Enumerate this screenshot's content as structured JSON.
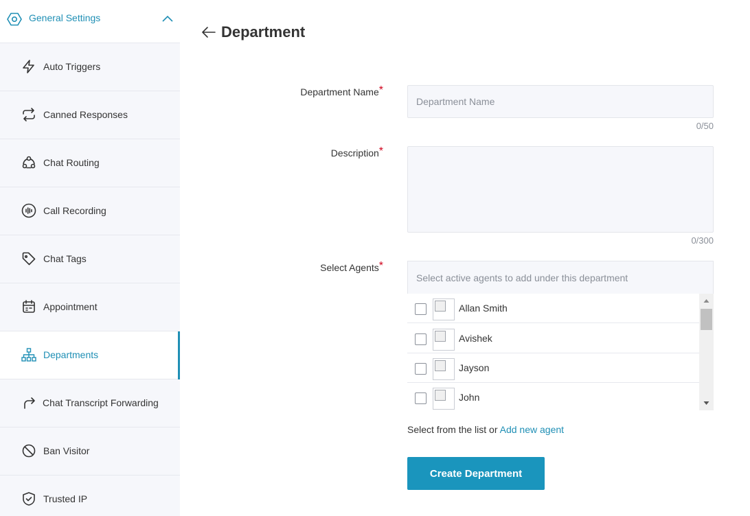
{
  "sidebar": {
    "header": {
      "label": "General Settings",
      "icon": "settings-hexagon-icon",
      "chevron": "chevron-up-icon"
    },
    "items": [
      {
        "label": "Auto Triggers",
        "icon": "lightning-icon",
        "active": false
      },
      {
        "label": "Canned Responses",
        "icon": "repeat-icon",
        "active": false
      },
      {
        "label": "Chat Routing",
        "icon": "routing-icon",
        "active": false
      },
      {
        "label": "Call Recording",
        "icon": "audio-wave-icon",
        "active": false
      },
      {
        "label": "Chat Tags",
        "icon": "tag-icon",
        "active": false
      },
      {
        "label": "Appointment",
        "icon": "calendar-icon",
        "active": false
      },
      {
        "label": "Departments",
        "icon": "org-chart-icon",
        "active": true
      },
      {
        "label": "Chat Transcript Forwarding",
        "icon": "forward-arrow-icon",
        "active": false
      },
      {
        "label": "Ban Visitor",
        "icon": "ban-icon",
        "active": false
      },
      {
        "label": "Trusted IP",
        "icon": "shield-check-icon",
        "active": false
      }
    ]
  },
  "main": {
    "title": "Department",
    "department_name": {
      "label": "Department Name",
      "required_mark": "*",
      "placeholder": "Department Name",
      "value": "",
      "counter": "0/50"
    },
    "description": {
      "label": "Description",
      "required_mark": "*",
      "value": "",
      "counter": "0/300"
    },
    "agents": {
      "label": "Select Agents",
      "required_mark": "*",
      "placeholder": "Select active agents to add under this department",
      "list": [
        {
          "name": "Allan Smith",
          "checked": false
        },
        {
          "name": "Avishek",
          "checked": false
        },
        {
          "name": "Jayson",
          "checked": false
        },
        {
          "name": "John",
          "checked": false
        }
      ]
    },
    "helper_text": "Select from the list or",
    "helper_link": "Add new agent",
    "create_button": "Create Department"
  },
  "colors": {
    "accent": "#1f8fb5",
    "button": "#1a95bd",
    "required": "#d0021b",
    "sidebar_bg": "#f6f7fb"
  }
}
